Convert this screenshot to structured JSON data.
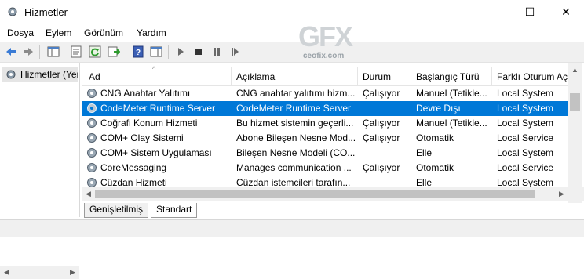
{
  "window": {
    "title": "Hizmetler",
    "minimize": "—",
    "maximize": "☐",
    "close": "✕"
  },
  "menu": [
    {
      "label": "Dosya"
    },
    {
      "label": "Eylem"
    },
    {
      "label": "Görünüm"
    },
    {
      "label": "Yardım"
    }
  ],
  "logo": {
    "text": "GFX",
    "sub": "ceofix.com"
  },
  "tree": {
    "item": "Hizmetler (Yerel)"
  },
  "columns": [
    "Ad",
    "Açıklama",
    "Durum",
    "Başlangıç Türü",
    "Farklı Oturum Aç"
  ],
  "rows": [
    {
      "name": "CNG Anahtar Yalıtımı",
      "desc": "CNG anahtar yalıtımı hizm...",
      "status": "Çalışıyor",
      "startup": "Manuel (Tetikle...",
      "logon": "Local System"
    },
    {
      "name": "CodeMeter Runtime Server",
      "desc": "CodeMeter Runtime Server",
      "status": "",
      "startup": "Devre Dışı",
      "logon": "Local System"
    },
    {
      "name": "Coğrafi Konum Hizmeti",
      "desc": "Bu hizmet sistemin geçerli...",
      "status": "Çalışıyor",
      "startup": "Manuel (Tetikle...",
      "logon": "Local System"
    },
    {
      "name": "COM+ Olay Sistemi",
      "desc": "Abone Bileşen Nesne Mod...",
      "status": "Çalışıyor",
      "startup": "Otomatik",
      "logon": "Local Service"
    },
    {
      "name": "COM+ Sistem Uygulaması",
      "desc": "Bileşen Nesne Modeli (CO...",
      "status": "",
      "startup": "Elle",
      "logon": "Local System"
    },
    {
      "name": "CoreMessaging",
      "desc": "Manages communication ...",
      "status": "Çalışıyor",
      "startup": "Otomatik",
      "logon": "Local Service"
    },
    {
      "name": "Cüzdan Hizmeti",
      "desc": "Cüzdan istemcileri tarafın...",
      "status": "",
      "startup": "Elle",
      "logon": "Local System"
    }
  ],
  "selected_row": 1,
  "tabs": [
    {
      "label": "Genişletilmiş"
    },
    {
      "label": "Standart"
    }
  ],
  "colors": {
    "selection": "#0078d7"
  }
}
